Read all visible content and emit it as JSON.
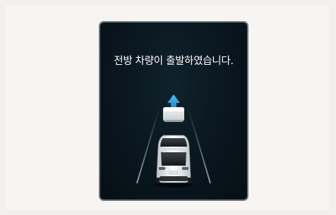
{
  "screen": {
    "message": "전방 차량이 출발하였습니다.",
    "icons": [
      "road-lanes-icon",
      "front-vehicle-icon",
      "departure-arrow-icon",
      "own-vehicle-icon"
    ],
    "colors": {
      "background": "#0a1820",
      "border": "#6f7478",
      "arrow": "#2fa8e6",
      "text": "#ffffff"
    }
  }
}
